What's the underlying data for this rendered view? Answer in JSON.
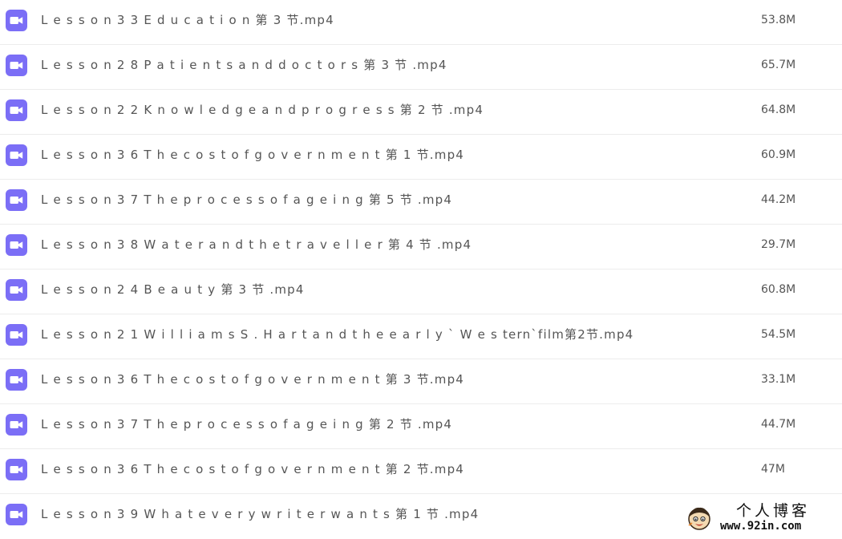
{
  "colors": {
    "icon_bg": "#7b6ef6",
    "text": "#555555",
    "divider": "#ececec"
  },
  "files": [
    {
      "name": "L e s s o n 3 3 E d u c a t i o n 第 3 节.mp4",
      "size": "53.8M",
      "icon": "video-icon"
    },
    {
      "name": "L e s s o n 2 8 P a t i e n t s a n d d o c t o r s 第 3 节 .mp4",
      "size": "65.7M",
      "icon": "video-icon"
    },
    {
      "name": "L e s s o n 2 2 K n o w l e d g e a n d p r o g r e s s 第 2 节 .mp4",
      "size": "64.8M",
      "icon": "video-icon"
    },
    {
      "name": "L e s s o n 3 6 T h e c o s t o f g o v e r n m e n t 第 1 节.mp4",
      "size": "60.9M",
      "icon": "video-icon"
    },
    {
      "name": "L e s s o n 3 7 T h e p r o c e s s o f a g e i n g 第 5 节 .mp4",
      "size": "44.2M",
      "icon": "video-icon"
    },
    {
      "name": "L e s s o n 3 8 W a t e r a n d t h e t r a v e l l e r 第 4 节 .mp4",
      "size": "29.7M",
      "icon": "video-icon"
    },
    {
      "name": "L e s s o n 2 4 B e a u t y 第 3 节 .mp4",
      "size": "60.8M",
      "icon": "video-icon"
    },
    {
      "name": "L e s s o n 2 1 W i l l i a m s S . H a r t a n d t h e e a r l y ` W e s tern`film第2节.mp4",
      "size": "54.5M",
      "icon": "video-icon"
    },
    {
      "name": "L e s s o n 3 6 T h e c o s t o f g o v e r n m e n t 第 3 节.mp4",
      "size": "33.1M",
      "icon": "video-icon"
    },
    {
      "name": "L e s s o n 3 7 T h e p r o c e s s o f a g e i n g 第 2 节 .mp4",
      "size": "44.7M",
      "icon": "video-icon"
    },
    {
      "name": "L e s s o n 3 6 T h e c o s t o f g o v e r n m e n t 第 2 节.mp4",
      "size": "47M",
      "icon": "video-icon"
    },
    {
      "name": "L e s s o n 3 9 W h a t e v e r y w r i t e r w a n t s 第 1 节 .mp4",
      "size": "",
      "icon": "video-icon"
    }
  ],
  "watermark": {
    "title": "个人博客",
    "url": "www.92in.com",
    "icon": "avatar-icon"
  }
}
